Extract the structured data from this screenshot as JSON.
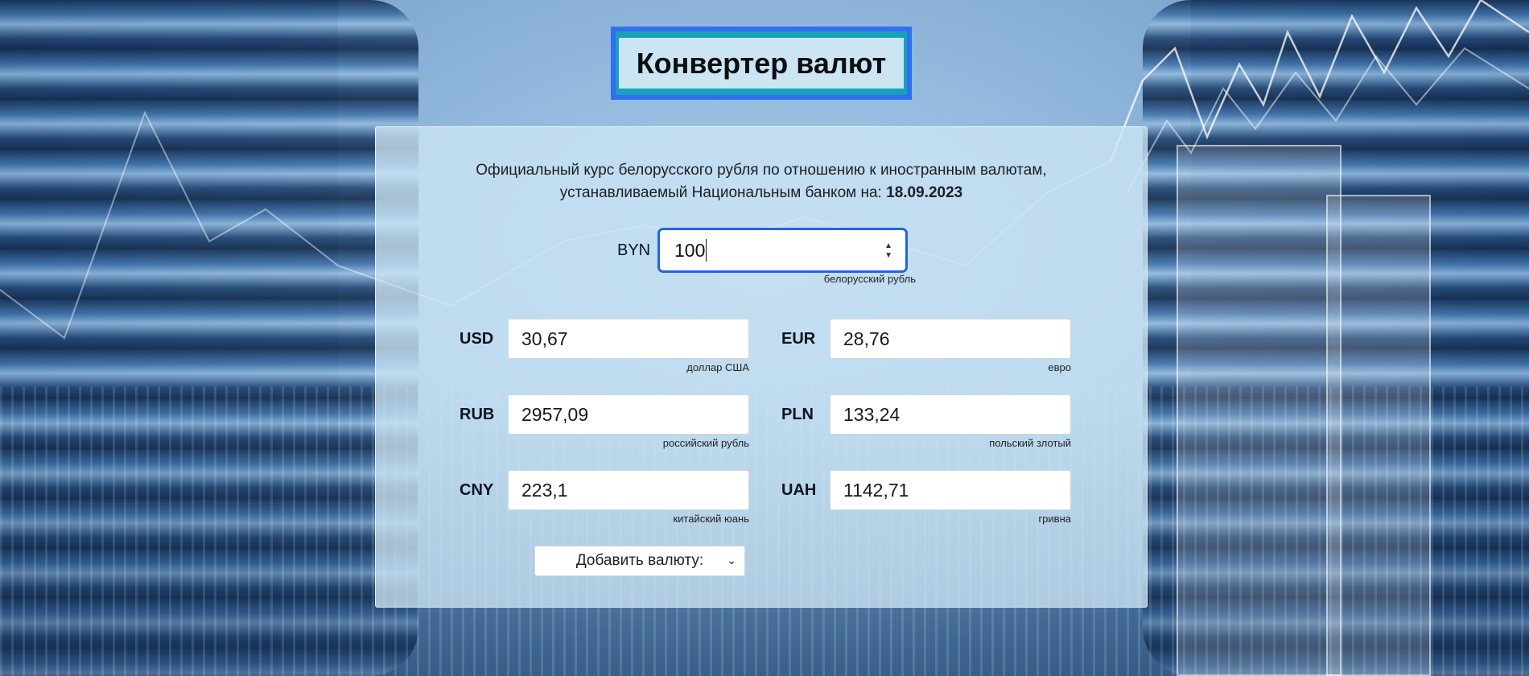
{
  "title": "Конвертер валют",
  "description": {
    "line1": "Официальный курс белорусского рубля по отношению к иностранным валютам,",
    "line2": "устанавливаемый Национальным банком на:",
    "date": "18.09.2023"
  },
  "base": {
    "code": "BYN",
    "value": "100",
    "name": "белорусский рубль"
  },
  "currencies": [
    {
      "code": "USD",
      "value": "30,67",
      "name": "доллар США"
    },
    {
      "code": "EUR",
      "value": "28,76",
      "name": "евро"
    },
    {
      "code": "RUB",
      "value": "2957,09",
      "name": "российский рубль"
    },
    {
      "code": "PLN",
      "value": "133,24",
      "name": "польский злотый"
    },
    {
      "code": "CNY",
      "value": "223,1",
      "name": "китайский юань"
    },
    {
      "code": "UAH",
      "value": "1142,71",
      "name": "гривна"
    }
  ],
  "add_currency": {
    "label": "Добавить валюту:"
  },
  "icons": {
    "spinner": "spin-arrows-icon",
    "select": "chevron-down-icon"
  },
  "colors": {
    "title_border": "#2f6ff0",
    "title_fill": "#1a9fbd",
    "focus_border": "#2763e0"
  }
}
